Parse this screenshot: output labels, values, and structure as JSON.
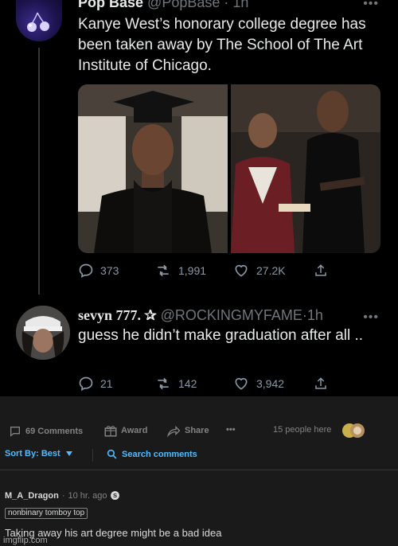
{
  "tweet1": {
    "name": "Pop Base",
    "handle": "@PopBase",
    "time": "1h",
    "text": "Kanye West’s honorary college degree has been taken away by The School of The Art Institute of Chicago.",
    "replies": "373",
    "retweets": "1,991",
    "likes": "27.2K"
  },
  "tweet2": {
    "name": "sevyn 777. ✰",
    "handle": "@ROCKINGMYFAME",
    "time": "1h",
    "text": "guess he didn’t make graduation after all ..",
    "replies": "21",
    "retweets": "142",
    "likes": "3,942"
  },
  "reddit": {
    "comments": "69 Comments",
    "award": "Award",
    "share": "Share",
    "more": "•••",
    "people_here": "15 people here",
    "sort_by": "Sort By: Best",
    "search_comments": "Search comments",
    "comment": {
      "user": "M_A_Dragon",
      "time": "10 hr. ago",
      "flair": "nonbinary tomboy top",
      "body": "Taking away his art degree might be a bad idea"
    }
  },
  "watermark": "imgflip.com",
  "colors": {
    "twitter_bg": "#000000",
    "reddit_bg": "#1a1a1b",
    "link_blue": "#4fbcff",
    "muted": "#818384"
  }
}
